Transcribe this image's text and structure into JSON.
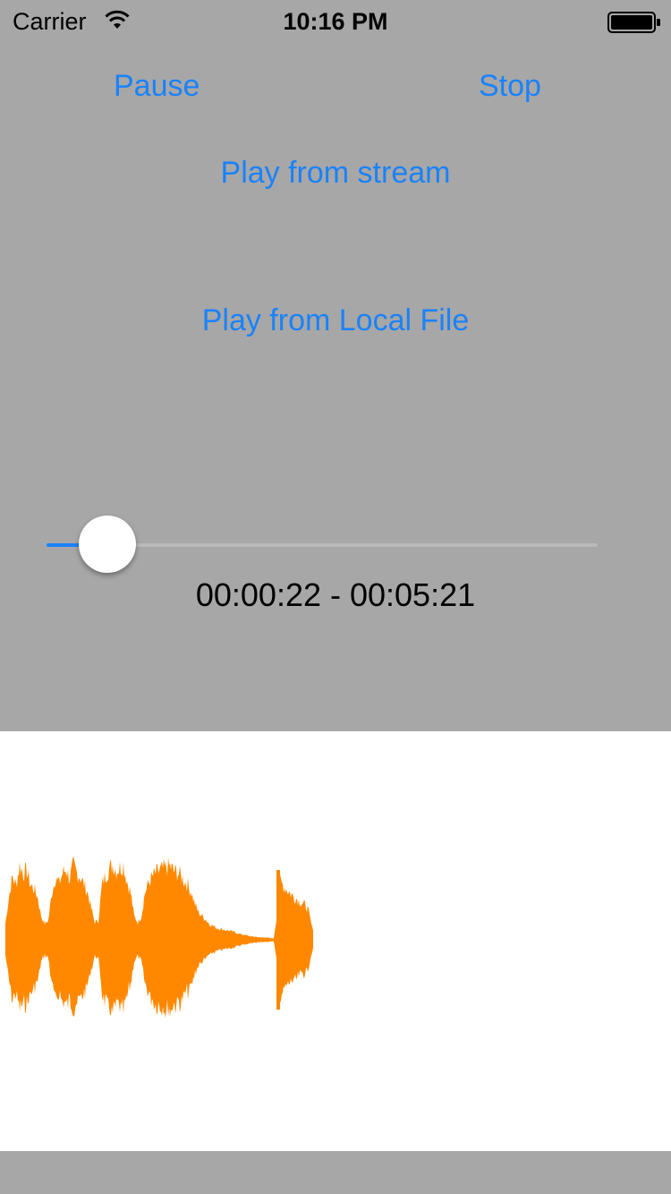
{
  "status_bar": {
    "carrier": "Carrier",
    "time": "10:16 PM"
  },
  "controls": {
    "pause_label": "Pause",
    "stop_label": "Stop",
    "play_stream_label": "Play from stream",
    "play_local_label": "Play from Local File"
  },
  "playback": {
    "position": "00:00:22",
    "duration": "00:05:21",
    "progress_fraction": 0.07,
    "time_text": "00:00:22 - 00:05:21"
  },
  "colors": {
    "accent": "#1a82fb",
    "waveform": "#ff8800",
    "background": "#a7a7a7",
    "panel": "#ffffff"
  },
  "icons": {
    "wifi": "wifi-icon",
    "battery": "battery-icon"
  }
}
